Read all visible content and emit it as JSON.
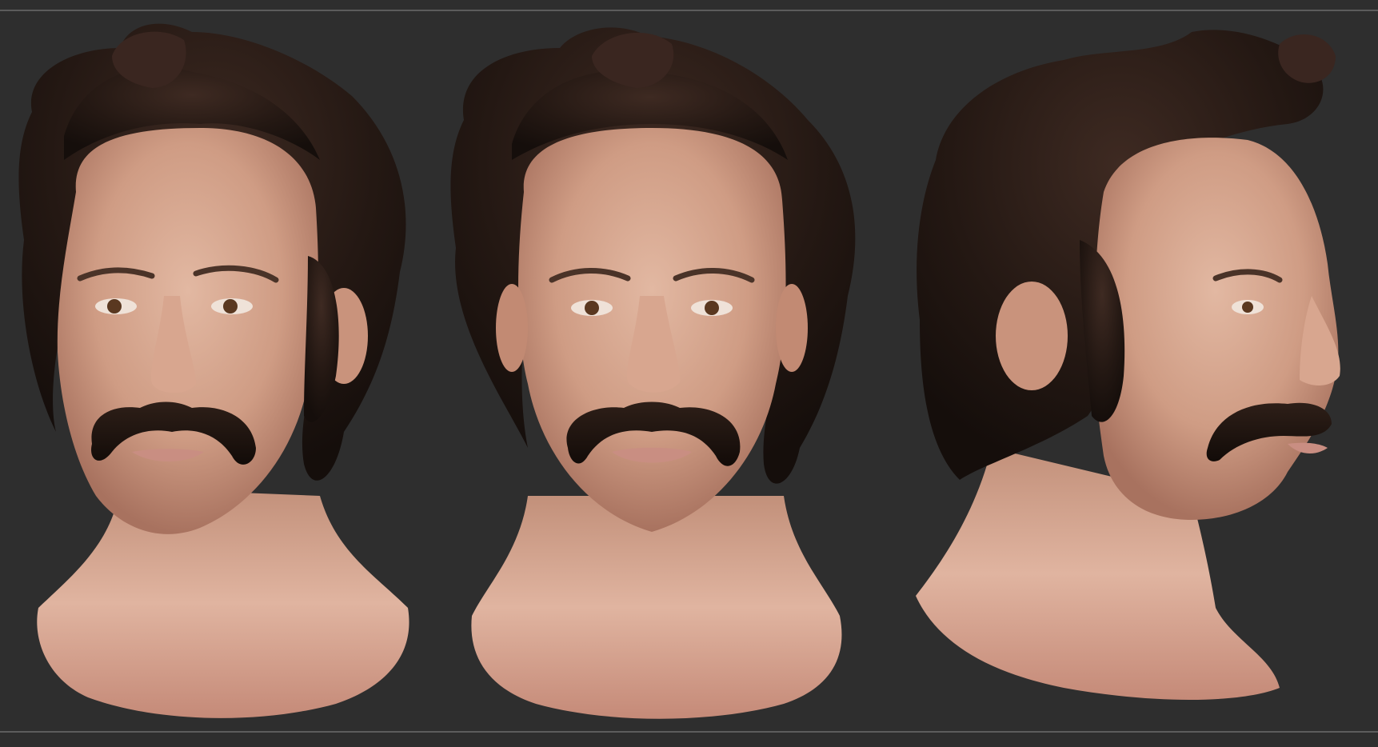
{
  "scene": {
    "background_color": "#2e2e2e",
    "rule_color": "#5c5c5c",
    "views": [
      {
        "name": "three-quarter-view",
        "facing": "left"
      },
      {
        "name": "front-view",
        "facing": "front"
      },
      {
        "name": "profile-view",
        "facing": "right"
      }
    ],
    "colors": {
      "skin": "#d9a890",
      "skin_shadow": "#a8725f",
      "hair": "#1e1410",
      "hair_highlight": "#4a3328",
      "moustache": "#1a110d",
      "iris": "#5a3820",
      "lips": "#c98e82"
    }
  }
}
